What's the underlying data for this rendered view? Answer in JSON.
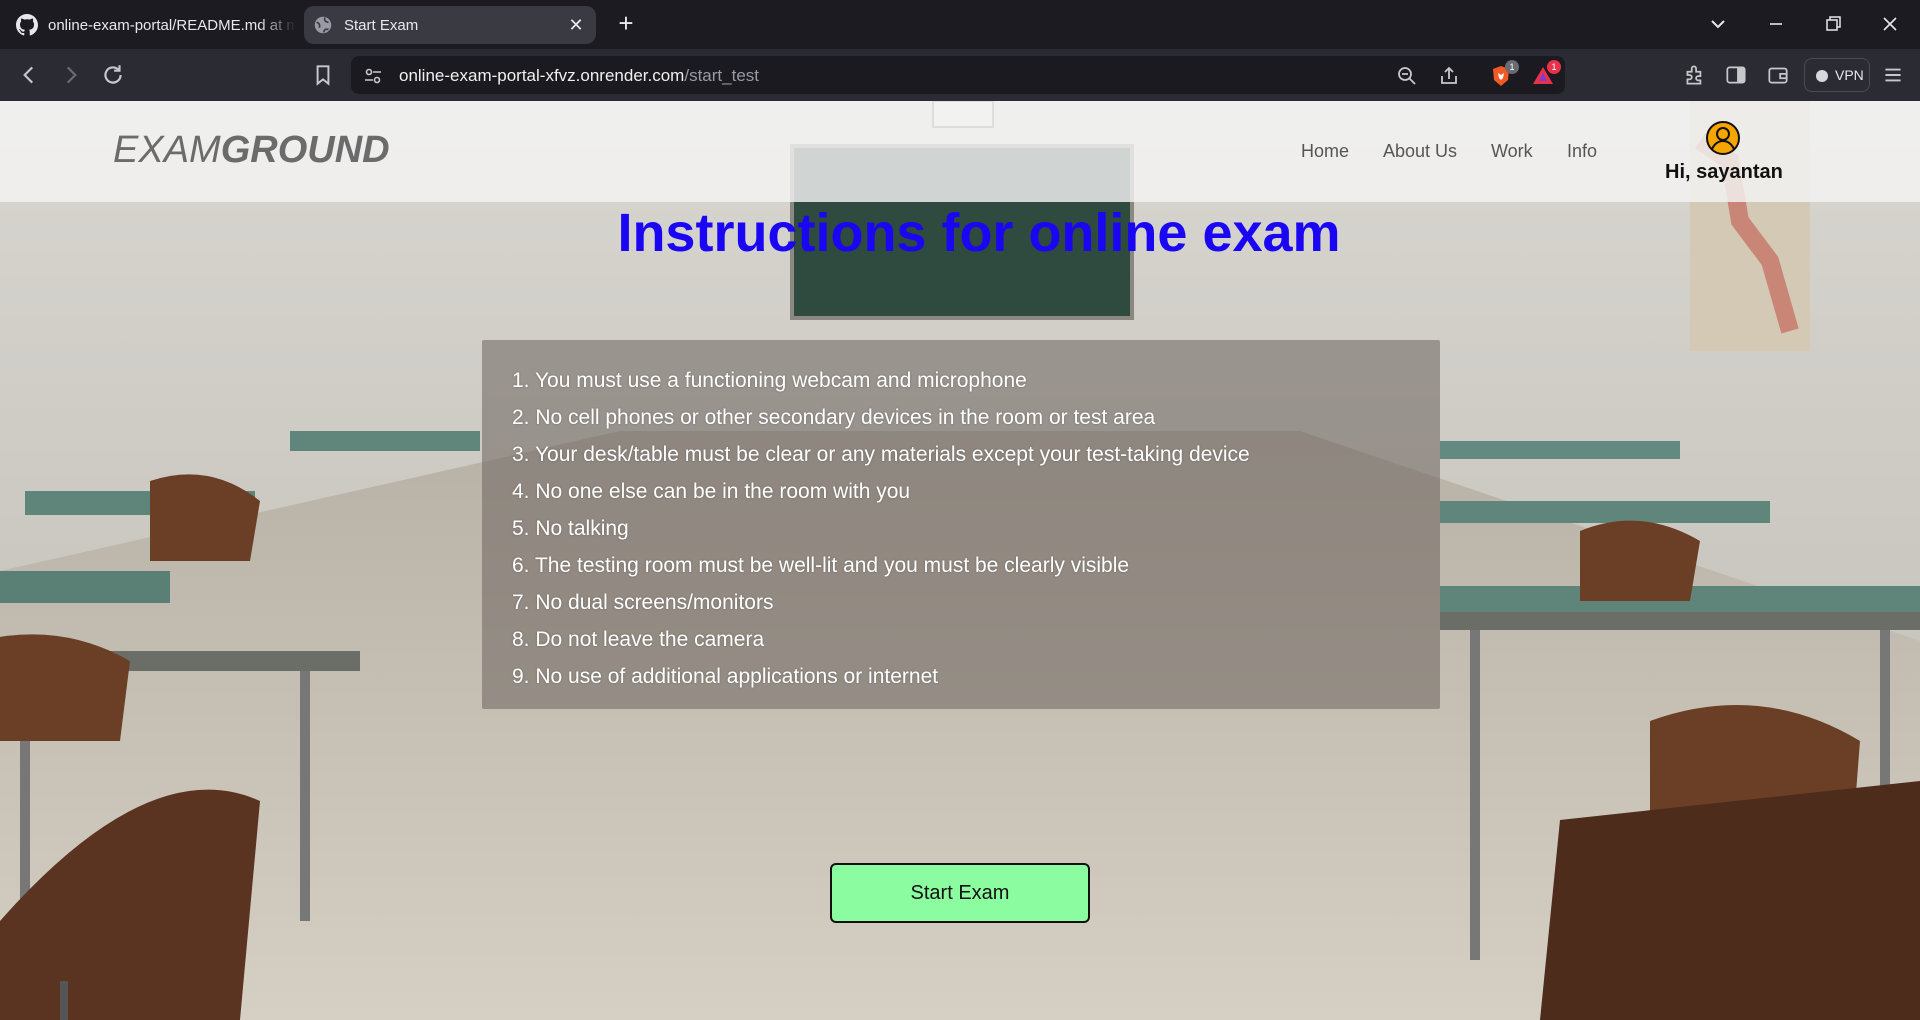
{
  "browser": {
    "tabs": [
      {
        "title": "online-exam-portal/README.md at main",
        "favicon": "github-icon",
        "active": false
      },
      {
        "title": "Start Exam",
        "favicon": "globe-icon",
        "active": true
      }
    ],
    "new_tab_label": "+",
    "close_glyph": "✕",
    "url_host": "online-exam-portal-xfvz.onrender.com",
    "url_path": "/start_test",
    "shield_badge": "1",
    "alert_badge": "1",
    "vpn_label": "VPN"
  },
  "header": {
    "logo_light": "EXAM",
    "logo_bold": "GROUND",
    "nav": [
      "Home",
      "About Us",
      "Work",
      "Info"
    ],
    "greeting": "Hi, sayantan"
  },
  "main": {
    "title": "Instructions for online exam",
    "rules": [
      "1. You must use a functioning webcam and microphone",
      "2. No cell phones or other secondary devices in the room or test area",
      "3. Your desk/table must be clear or any materials except your test-taking device",
      "4. No one else can be in the room with you",
      "5. No talking",
      "6. The testing room must be well-lit and you must be clearly visible",
      "7. No dual screens/monitors",
      "8. Do not leave the camera",
      "9. No use of additional applications or internet"
    ],
    "start_button": "Start Exam"
  },
  "colors": {
    "title": "#1a06f2",
    "button": "#8cfca0",
    "browser_bg": "#1b1b21"
  }
}
